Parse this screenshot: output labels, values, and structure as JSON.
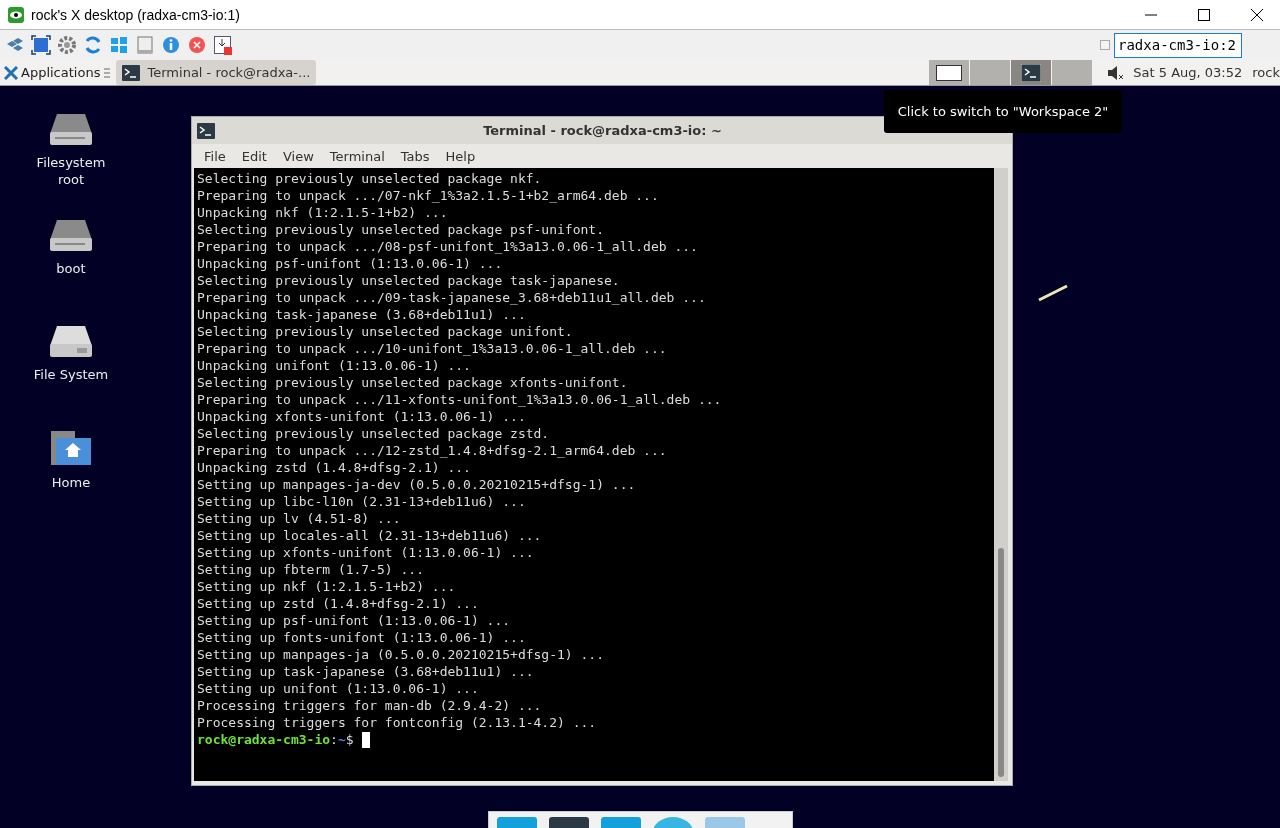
{
  "viewer": {
    "title": "rock's X desktop (radxa-cm3-io:1)",
    "address": "radxa-cm3-io:2",
    "checkbox_checked": false
  },
  "panel": {
    "applications": "Applications",
    "task": "Terminal - rock@radxa-...",
    "workspaces": [
      {
        "kind": "window",
        "selected": false
      },
      {
        "kind": "empty",
        "selected": false
      },
      {
        "kind": "terminal",
        "selected": true
      },
      {
        "kind": "empty",
        "selected": false
      }
    ],
    "clock": "Sat  5 Aug, 03:52",
    "user": "rock"
  },
  "tooltip": "Click to switch to \"Workspace 2\"",
  "desktop_icons": [
    {
      "label": "Filesystem root",
      "kind": "drive"
    },
    {
      "label": "boot",
      "kind": "drive"
    },
    {
      "label": "File System",
      "kind": "disk"
    },
    {
      "label": "Home",
      "kind": "home"
    }
  ],
  "terminal": {
    "title": "Terminal - rock@radxa-cm3-io: ~",
    "menu": [
      "File",
      "Edit",
      "View",
      "Terminal",
      "Tabs",
      "Help"
    ],
    "lines": [
      "Selecting previously unselected package nkf.",
      "Preparing to unpack .../07-nkf_1%3a2.1.5-1+b2_arm64.deb ...",
      "Unpacking nkf (1:2.1.5-1+b2) ...",
      "Selecting previously unselected package psf-unifont.",
      "Preparing to unpack .../08-psf-unifont_1%3a13.0.06-1_all.deb ...",
      "Unpacking psf-unifont (1:13.0.06-1) ...",
      "Selecting previously unselected package task-japanese.",
      "Preparing to unpack .../09-task-japanese_3.68+deb11u1_all.deb ...",
      "Unpacking task-japanese (3.68+deb11u1) ...",
      "Selecting previously unselected package unifont.",
      "Preparing to unpack .../10-unifont_1%3a13.0.06-1_all.deb ...",
      "Unpacking unifont (1:13.0.06-1) ...",
      "Selecting previously unselected package xfonts-unifont.",
      "Preparing to unpack .../11-xfonts-unifont_1%3a13.0.06-1_all.deb ...",
      "Unpacking xfonts-unifont (1:13.0.06-1) ...",
      "Selecting previously unselected package zstd.",
      "Preparing to unpack .../12-zstd_1.4.8+dfsg-2.1_arm64.deb ...",
      "Unpacking zstd (1.4.8+dfsg-2.1) ...",
      "Setting up manpages-ja-dev (0.5.0.0.20210215+dfsg-1) ...",
      "Setting up libc-l10n (2.31-13+deb11u6) ...",
      "Setting up lv (4.51-8) ...",
      "Setting up locales-all (2.31-13+deb11u6) ...",
      "Setting up xfonts-unifont (1:13.0.06-1) ...",
      "Setting up fbterm (1.7-5) ...",
      "Setting up nkf (1:2.1.5-1+b2) ...",
      "Setting up zstd (1.4.8+dfsg-2.1) ...",
      "Setting up psf-unifont (1:13.0.06-1) ...",
      "Setting up fonts-unifont (1:13.0.06-1) ...",
      "Setting up manpages-ja (0.5.0.0.20210215+dfsg-1) ...",
      "Setting up task-japanese (3.68+deb11u1) ...",
      "Setting up unifont (1:13.0.06-1) ...",
      "Processing triggers for man-db (2.9.4-2) ...",
      "Processing triggers for fontconfig (2.13.1-4.2) ..."
    ],
    "prompt": {
      "user_host": "rock@radxa-cm3-io",
      "separator": ":",
      "path": "~",
      "symbol": "$"
    }
  }
}
